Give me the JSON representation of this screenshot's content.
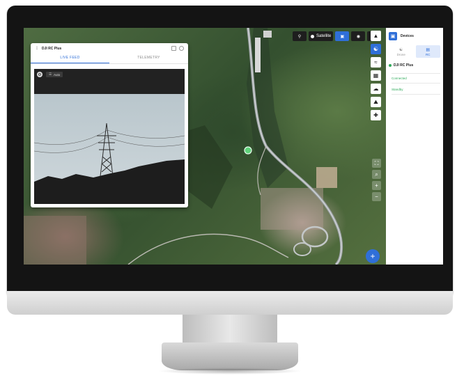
{
  "colors": {
    "accent": "#2f6fd8",
    "status_ok": "#2faa5a",
    "drone_marker": "#5fd27a"
  },
  "map": {
    "toolbar": {
      "search_icon": "search-icon",
      "satellite_label": "Satellite"
    },
    "tools": [
      "layers-icon",
      "drone-icon",
      "route-icon",
      "grid-icon",
      "cloud-icon",
      "terrain-icon",
      "plus-icon"
    ],
    "zoom": [
      "fullscreen-icon",
      "search-icon",
      "zoom-in-icon",
      "zoom-out-icon"
    ],
    "fab_label": "+"
  },
  "panel": {
    "title": "DJI RC Plus",
    "tabs": [
      {
        "label": "LIVE FEED",
        "active": true
      },
      {
        "label": "TELEMETRY",
        "active": false
      }
    ],
    "video_mode_label": "Auto"
  },
  "sidebar": {
    "title": "Devices",
    "tabs": [
      {
        "label": "Drone",
        "active": false
      },
      {
        "label": "RC",
        "active": true
      }
    ],
    "device_name": "DJI RC Plus",
    "status_rows": [
      "Connected",
      "Standby"
    ]
  }
}
